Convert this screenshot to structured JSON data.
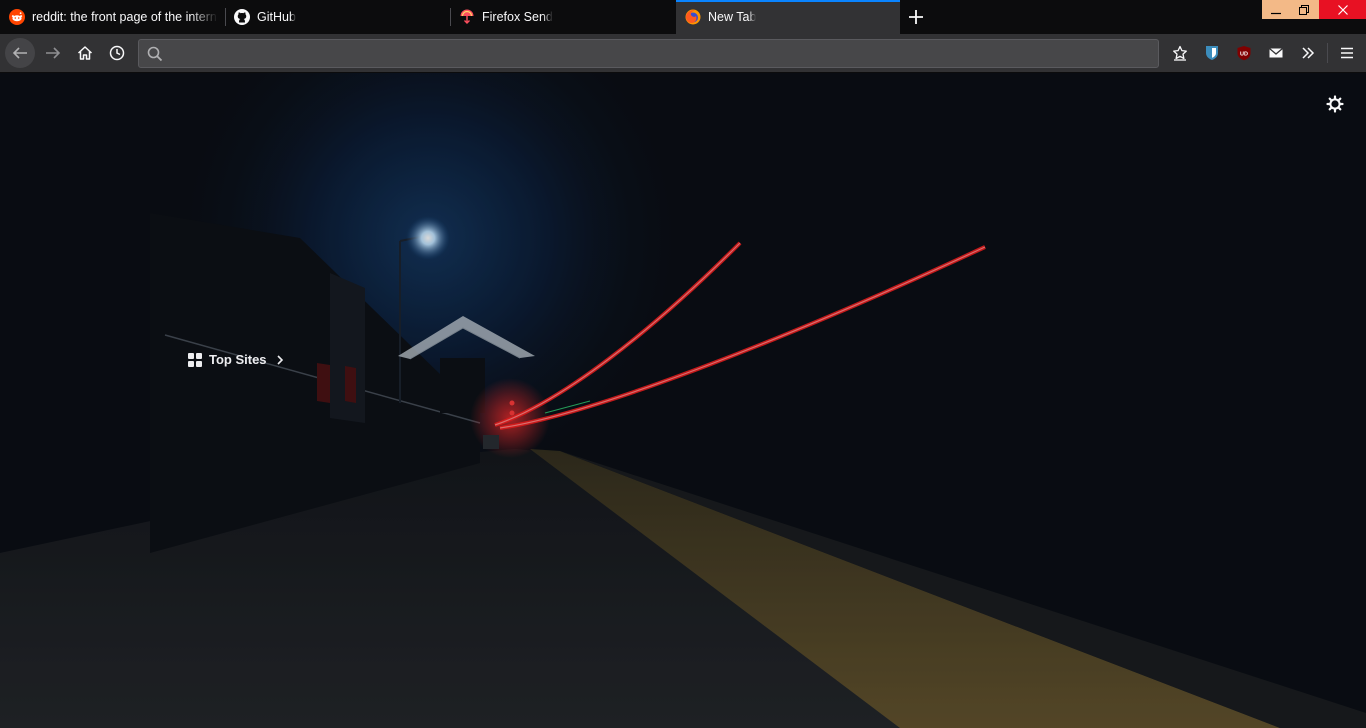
{
  "tabs": [
    {
      "title": "reddit: the front page of the internet",
      "favicon": "reddit-icon",
      "active": false
    },
    {
      "title": "GitHub",
      "favicon": "github-icon",
      "active": false
    },
    {
      "title": "Firefox Send",
      "favicon": "firefox-send-icon",
      "active": false
    },
    {
      "title": "New Tab",
      "favicon": "firefox-icon",
      "active": true
    }
  ],
  "urlbar": {
    "value": "",
    "placeholder": ""
  },
  "toolbar_icons": [
    "bookmark-star-icon",
    "bitwarden-icon",
    "ublock-origin-icon",
    "mail-icon",
    "overflow-chevron-icon",
    "hamburger-menu-icon"
  ],
  "nav_icons": [
    "back-arrow-icon",
    "forward-arrow-icon",
    "home-icon",
    "history-clock-icon"
  ],
  "newtab": {
    "top_sites_label": "Top Sites"
  },
  "colors": {
    "accent": "#0a84ff",
    "tab_bar": "#0c0c0d",
    "toolbar": "#323234",
    "close_button": "#e81123",
    "window_button": "#f3b987"
  }
}
